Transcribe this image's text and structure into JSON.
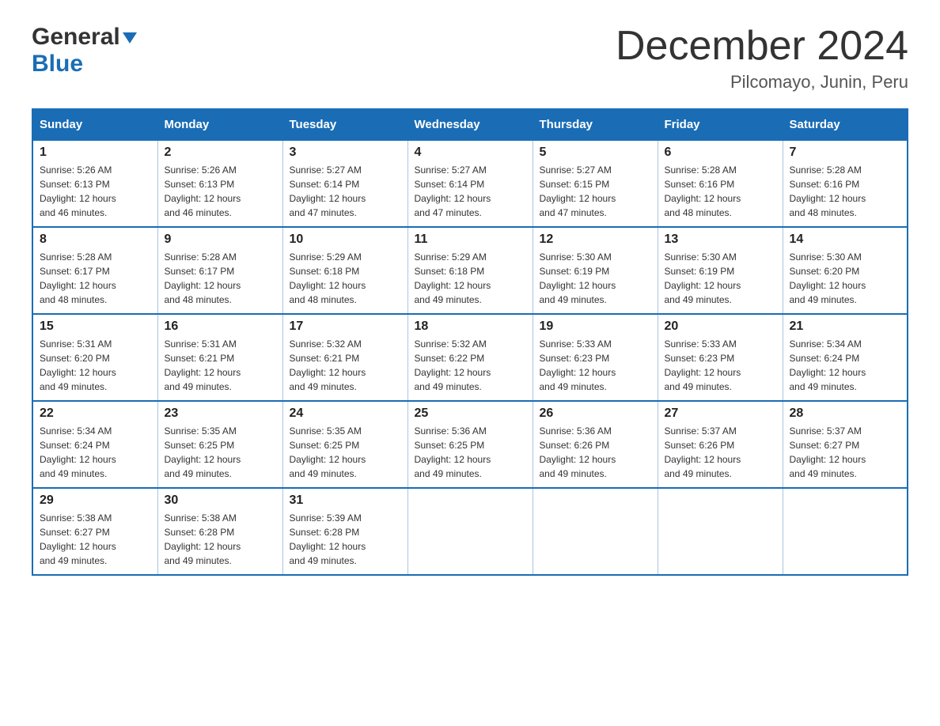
{
  "header": {
    "logo_general": "General",
    "logo_blue": "Blue",
    "month_title": "December 2024",
    "location": "Pilcomayo, Junin, Peru"
  },
  "calendar": {
    "days_of_week": [
      "Sunday",
      "Monday",
      "Tuesday",
      "Wednesday",
      "Thursday",
      "Friday",
      "Saturday"
    ],
    "weeks": [
      [
        {
          "day": "1",
          "sunrise": "5:26 AM",
          "sunset": "6:13 PM",
          "daylight": "12 hours and 46 minutes."
        },
        {
          "day": "2",
          "sunrise": "5:26 AM",
          "sunset": "6:13 PM",
          "daylight": "12 hours and 46 minutes."
        },
        {
          "day": "3",
          "sunrise": "5:27 AM",
          "sunset": "6:14 PM",
          "daylight": "12 hours and 47 minutes."
        },
        {
          "day": "4",
          "sunrise": "5:27 AM",
          "sunset": "6:14 PM",
          "daylight": "12 hours and 47 minutes."
        },
        {
          "day": "5",
          "sunrise": "5:27 AM",
          "sunset": "6:15 PM",
          "daylight": "12 hours and 47 minutes."
        },
        {
          "day": "6",
          "sunrise": "5:28 AM",
          "sunset": "6:16 PM",
          "daylight": "12 hours and 48 minutes."
        },
        {
          "day": "7",
          "sunrise": "5:28 AM",
          "sunset": "6:16 PM",
          "daylight": "12 hours and 48 minutes."
        }
      ],
      [
        {
          "day": "8",
          "sunrise": "5:28 AM",
          "sunset": "6:17 PM",
          "daylight": "12 hours and 48 minutes."
        },
        {
          "day": "9",
          "sunrise": "5:28 AM",
          "sunset": "6:17 PM",
          "daylight": "12 hours and 48 minutes."
        },
        {
          "day": "10",
          "sunrise": "5:29 AM",
          "sunset": "6:18 PM",
          "daylight": "12 hours and 48 minutes."
        },
        {
          "day": "11",
          "sunrise": "5:29 AM",
          "sunset": "6:18 PM",
          "daylight": "12 hours and 49 minutes."
        },
        {
          "day": "12",
          "sunrise": "5:30 AM",
          "sunset": "6:19 PM",
          "daylight": "12 hours and 49 minutes."
        },
        {
          "day": "13",
          "sunrise": "5:30 AM",
          "sunset": "6:19 PM",
          "daylight": "12 hours and 49 minutes."
        },
        {
          "day": "14",
          "sunrise": "5:30 AM",
          "sunset": "6:20 PM",
          "daylight": "12 hours and 49 minutes."
        }
      ],
      [
        {
          "day": "15",
          "sunrise": "5:31 AM",
          "sunset": "6:20 PM",
          "daylight": "12 hours and 49 minutes."
        },
        {
          "day": "16",
          "sunrise": "5:31 AM",
          "sunset": "6:21 PM",
          "daylight": "12 hours and 49 minutes."
        },
        {
          "day": "17",
          "sunrise": "5:32 AM",
          "sunset": "6:21 PM",
          "daylight": "12 hours and 49 minutes."
        },
        {
          "day": "18",
          "sunrise": "5:32 AM",
          "sunset": "6:22 PM",
          "daylight": "12 hours and 49 minutes."
        },
        {
          "day": "19",
          "sunrise": "5:33 AM",
          "sunset": "6:23 PM",
          "daylight": "12 hours and 49 minutes."
        },
        {
          "day": "20",
          "sunrise": "5:33 AM",
          "sunset": "6:23 PM",
          "daylight": "12 hours and 49 minutes."
        },
        {
          "day": "21",
          "sunrise": "5:34 AM",
          "sunset": "6:24 PM",
          "daylight": "12 hours and 49 minutes."
        }
      ],
      [
        {
          "day": "22",
          "sunrise": "5:34 AM",
          "sunset": "6:24 PM",
          "daylight": "12 hours and 49 minutes."
        },
        {
          "day": "23",
          "sunrise": "5:35 AM",
          "sunset": "6:25 PM",
          "daylight": "12 hours and 49 minutes."
        },
        {
          "day": "24",
          "sunrise": "5:35 AM",
          "sunset": "6:25 PM",
          "daylight": "12 hours and 49 minutes."
        },
        {
          "day": "25",
          "sunrise": "5:36 AM",
          "sunset": "6:25 PM",
          "daylight": "12 hours and 49 minutes."
        },
        {
          "day": "26",
          "sunrise": "5:36 AM",
          "sunset": "6:26 PM",
          "daylight": "12 hours and 49 minutes."
        },
        {
          "day": "27",
          "sunrise": "5:37 AM",
          "sunset": "6:26 PM",
          "daylight": "12 hours and 49 minutes."
        },
        {
          "day": "28",
          "sunrise": "5:37 AM",
          "sunset": "6:27 PM",
          "daylight": "12 hours and 49 minutes."
        }
      ],
      [
        {
          "day": "29",
          "sunrise": "5:38 AM",
          "sunset": "6:27 PM",
          "daylight": "12 hours and 49 minutes."
        },
        {
          "day": "30",
          "sunrise": "5:38 AM",
          "sunset": "6:28 PM",
          "daylight": "12 hours and 49 minutes."
        },
        {
          "day": "31",
          "sunrise": "5:39 AM",
          "sunset": "6:28 PM",
          "daylight": "12 hours and 49 minutes."
        },
        null,
        null,
        null,
        null
      ]
    ],
    "labels": {
      "sunrise": "Sunrise:",
      "sunset": "Sunset:",
      "daylight": "Daylight:"
    }
  }
}
